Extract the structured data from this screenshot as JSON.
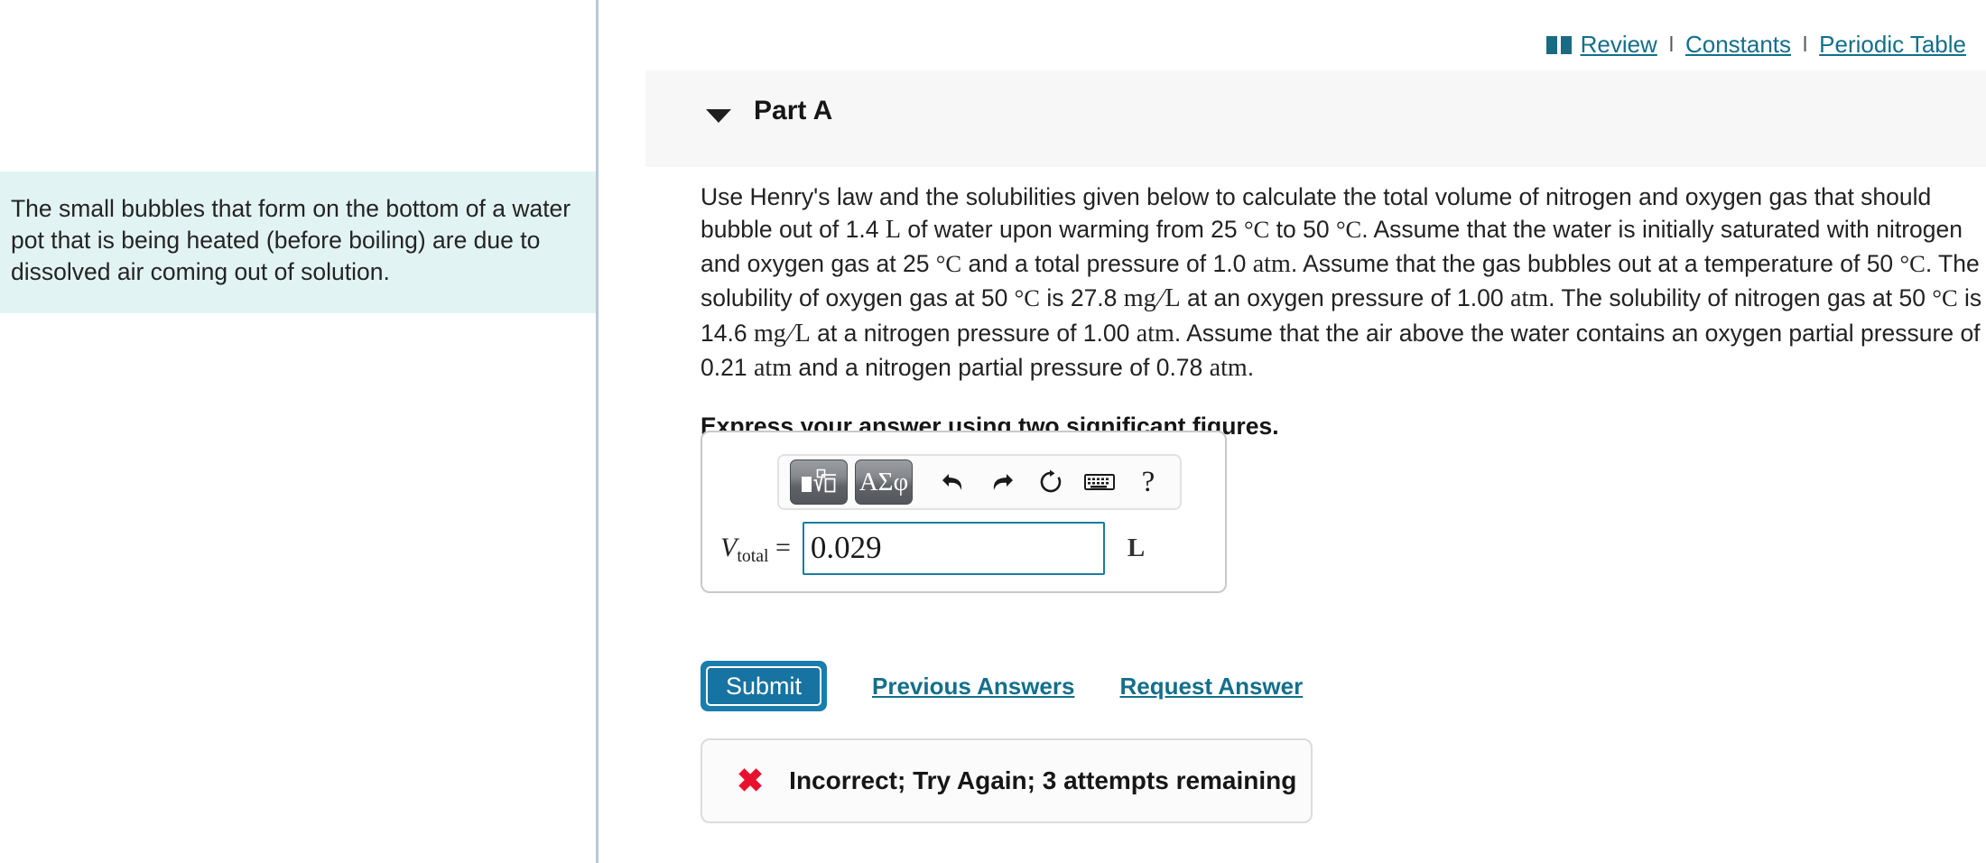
{
  "top_links": {
    "book_icon": "book-icon",
    "review": "Review",
    "constants": "Constants",
    "periodic_table": "Periodic Table",
    "separator": "l"
  },
  "hint": {
    "text": "The small bubbles that form on the bottom of a water pot that is being heated (before boiling) are due to dissolved air coming out of solution."
  },
  "part": {
    "caret": "triangle-down-icon",
    "title": "Part A"
  },
  "question": {
    "text": "Use Henry's law and the solubilities given below to calculate the total volume of nitrogen and oxygen gas that should bubble out of 1.4 L of water upon warming from 25 °C to 50 °C. Assume that the water is initially saturated with nitrogen and oxygen gas at 25 °C and a total pressure of 1.0 atm. Assume that the gas bubbles out at a temperature of 50 °C. The solubility of oxygen gas at 50 °C is 27.8 mg/L at an oxygen pressure of 1.00 atm. The solubility of nitrogen gas at 50 °C is 14.6 mg/L at a nitrogen pressure of 1.00 atm. Assume that the air above the water contains an oxygen partial pressure of 0.21 atm and a nitrogen partial pressure of 0.78 atm.",
    "values": {
      "water_volume": "1.4 L",
      "temp_initial": "25 °C",
      "temp_final": "50 °C",
      "total_pressure": "1.0 atm",
      "oxygen_solubility": "27.8 mg/L",
      "oxygen_pressure": "1.00 atm",
      "nitrogen_solubility": "14.6 mg/L",
      "nitrogen_pressure": "1.00 atm",
      "oxygen_partial_pressure": "0.21 atm",
      "nitrogen_partial_pressure": "0.78 atm"
    },
    "instruction": "Express your answer using two significant figures."
  },
  "toolbar": {
    "template_button": "template-math-icon",
    "greek_button": "ΑΣφ",
    "undo": "undo-arrow-icon",
    "redo": "redo-arrow-icon",
    "reset": "reset-circular-arrow-icon",
    "keyboard": "keyboard-icon",
    "help": "?"
  },
  "answer": {
    "variable": "V",
    "subscript": "total",
    "equals": "=",
    "value": "0.029",
    "placeholder": "",
    "unit": "L"
  },
  "actions": {
    "submit": "Submit",
    "previous_answers": "Previous Answers",
    "request_answer": "Request Answer"
  },
  "feedback": {
    "icon": "x-mark-icon",
    "message": "Incorrect; Try Again; 3 attempts remaining"
  },
  "colors": {
    "link": "#136f8b",
    "hint_background": "#e2f3f3",
    "input_border": "#1a7d9e",
    "submit": "#1773a2",
    "error": "#e8112d",
    "band": "#f7f7f7",
    "divider": "#b9c8d6"
  }
}
